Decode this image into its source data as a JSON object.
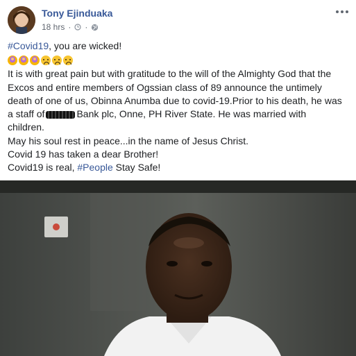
{
  "author": {
    "name": "Tony Ejinduaka",
    "timestamp": "18 hrs"
  },
  "icons": {
    "more": "more-horizontal-icon",
    "clock": "clock-icon",
    "audience": "globe-icon",
    "pray": "pray-emoji-icon",
    "sad": "sad-emoji-icon"
  },
  "post": {
    "line1_hashtag": "#Covid19",
    "line1_rest": ", you are wicked!",
    "para": [
      "It is with great pain but with gratitude to the will of the Almighty God that the",
      "Excos and entire members of Ogssian class of 89 announce the untimely",
      "death of one of us, Obinna Anumba due to covid-19.Prior to his death, he was"
    ],
    "staff_prefix": "a staff of",
    "staff_suffix": "Bank plc, Onne, PH River State. He was married with",
    "children": "children.",
    "rest_line": "May his soul rest in peace...in the name of Jesus Christ.",
    "brother_line": "Covid 19 has taken a dear Brother!",
    "last_prefix": "Covid19 is real, ",
    "last_hashtag": "#People",
    "last_suffix": " Stay Safe!"
  },
  "colors": {
    "link": "#385898",
    "text": "#1c1e21",
    "meta": "#616770"
  }
}
